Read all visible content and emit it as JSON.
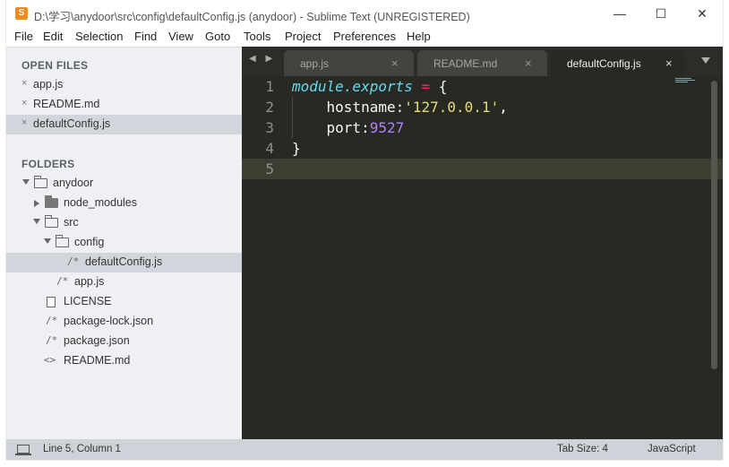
{
  "window": {
    "title": "D:\\学习\\anydoor\\src\\config\\defaultConfig.js (anydoor) - Sublime Text (UNREGISTERED)",
    "app_icon_glyph": "S",
    "controls": {
      "minimize": "—",
      "maximize": "☐",
      "close": "✕"
    }
  },
  "menu": [
    "File",
    "Edit",
    "Selection",
    "Find",
    "View",
    "Goto",
    "Tools",
    "Project",
    "Preferences",
    "Help"
  ],
  "sidebar": {
    "open_files_header": "OPEN FILES",
    "open_files": [
      "app.js",
      "README.md",
      "defaultConfig.js"
    ],
    "close_glyph": "×",
    "folders_header": "FOLDERS",
    "tree": [
      {
        "label": "anydoor",
        "type": "folder-open",
        "icon": "folder-open-icon"
      },
      {
        "label": "node_modules",
        "type": "folder-closed",
        "icon": "folder-icon"
      },
      {
        "label": "src",
        "type": "folder-open",
        "icon": "folder-open-icon"
      },
      {
        "label": "config",
        "type": "folder-open",
        "icon": "folder-open-icon"
      },
      {
        "label": "defaultConfig.js",
        "type": "file",
        "glyph": "/*"
      },
      {
        "label": "app.js",
        "type": "file",
        "glyph": "/*"
      },
      {
        "label": "LICENSE",
        "type": "file-doc",
        "icon": "document-icon"
      },
      {
        "label": "package-lock.json",
        "type": "file",
        "glyph": "/*"
      },
      {
        "label": "package.json",
        "type": "file",
        "glyph": "/*"
      },
      {
        "label": "README.md",
        "type": "file",
        "glyph": "<>"
      }
    ]
  },
  "tabs": {
    "nav_glyph": "◀ ▶",
    "items": [
      {
        "label": "app.js",
        "active": false
      },
      {
        "label": "README.md",
        "active": false
      },
      {
        "label": "defaultConfig.js",
        "active": true
      }
    ],
    "close_glyph": "×"
  },
  "editor": {
    "line_numbers": [
      "1",
      "2",
      "3",
      "4",
      "5"
    ],
    "current_line": 5,
    "code": {
      "l1_keyword": "module.exports",
      "l1_op": " = ",
      "l1_brace": "{",
      "l2_key": "    hostname:",
      "l2_str": "'127.0.0.1'",
      "l2_comma": ",",
      "l3_key": "    port:",
      "l3_num": "9527",
      "l4": "}"
    }
  },
  "status": {
    "position": "Line 5, Column 1",
    "tab_size": "Tab Size: 4",
    "syntax": "JavaScript"
  },
  "colors": {
    "editor_bg": "#282923",
    "keyword": "#66d9ef",
    "operator": "#f92672",
    "string": "#e6db74",
    "number": "#ae81ff"
  }
}
